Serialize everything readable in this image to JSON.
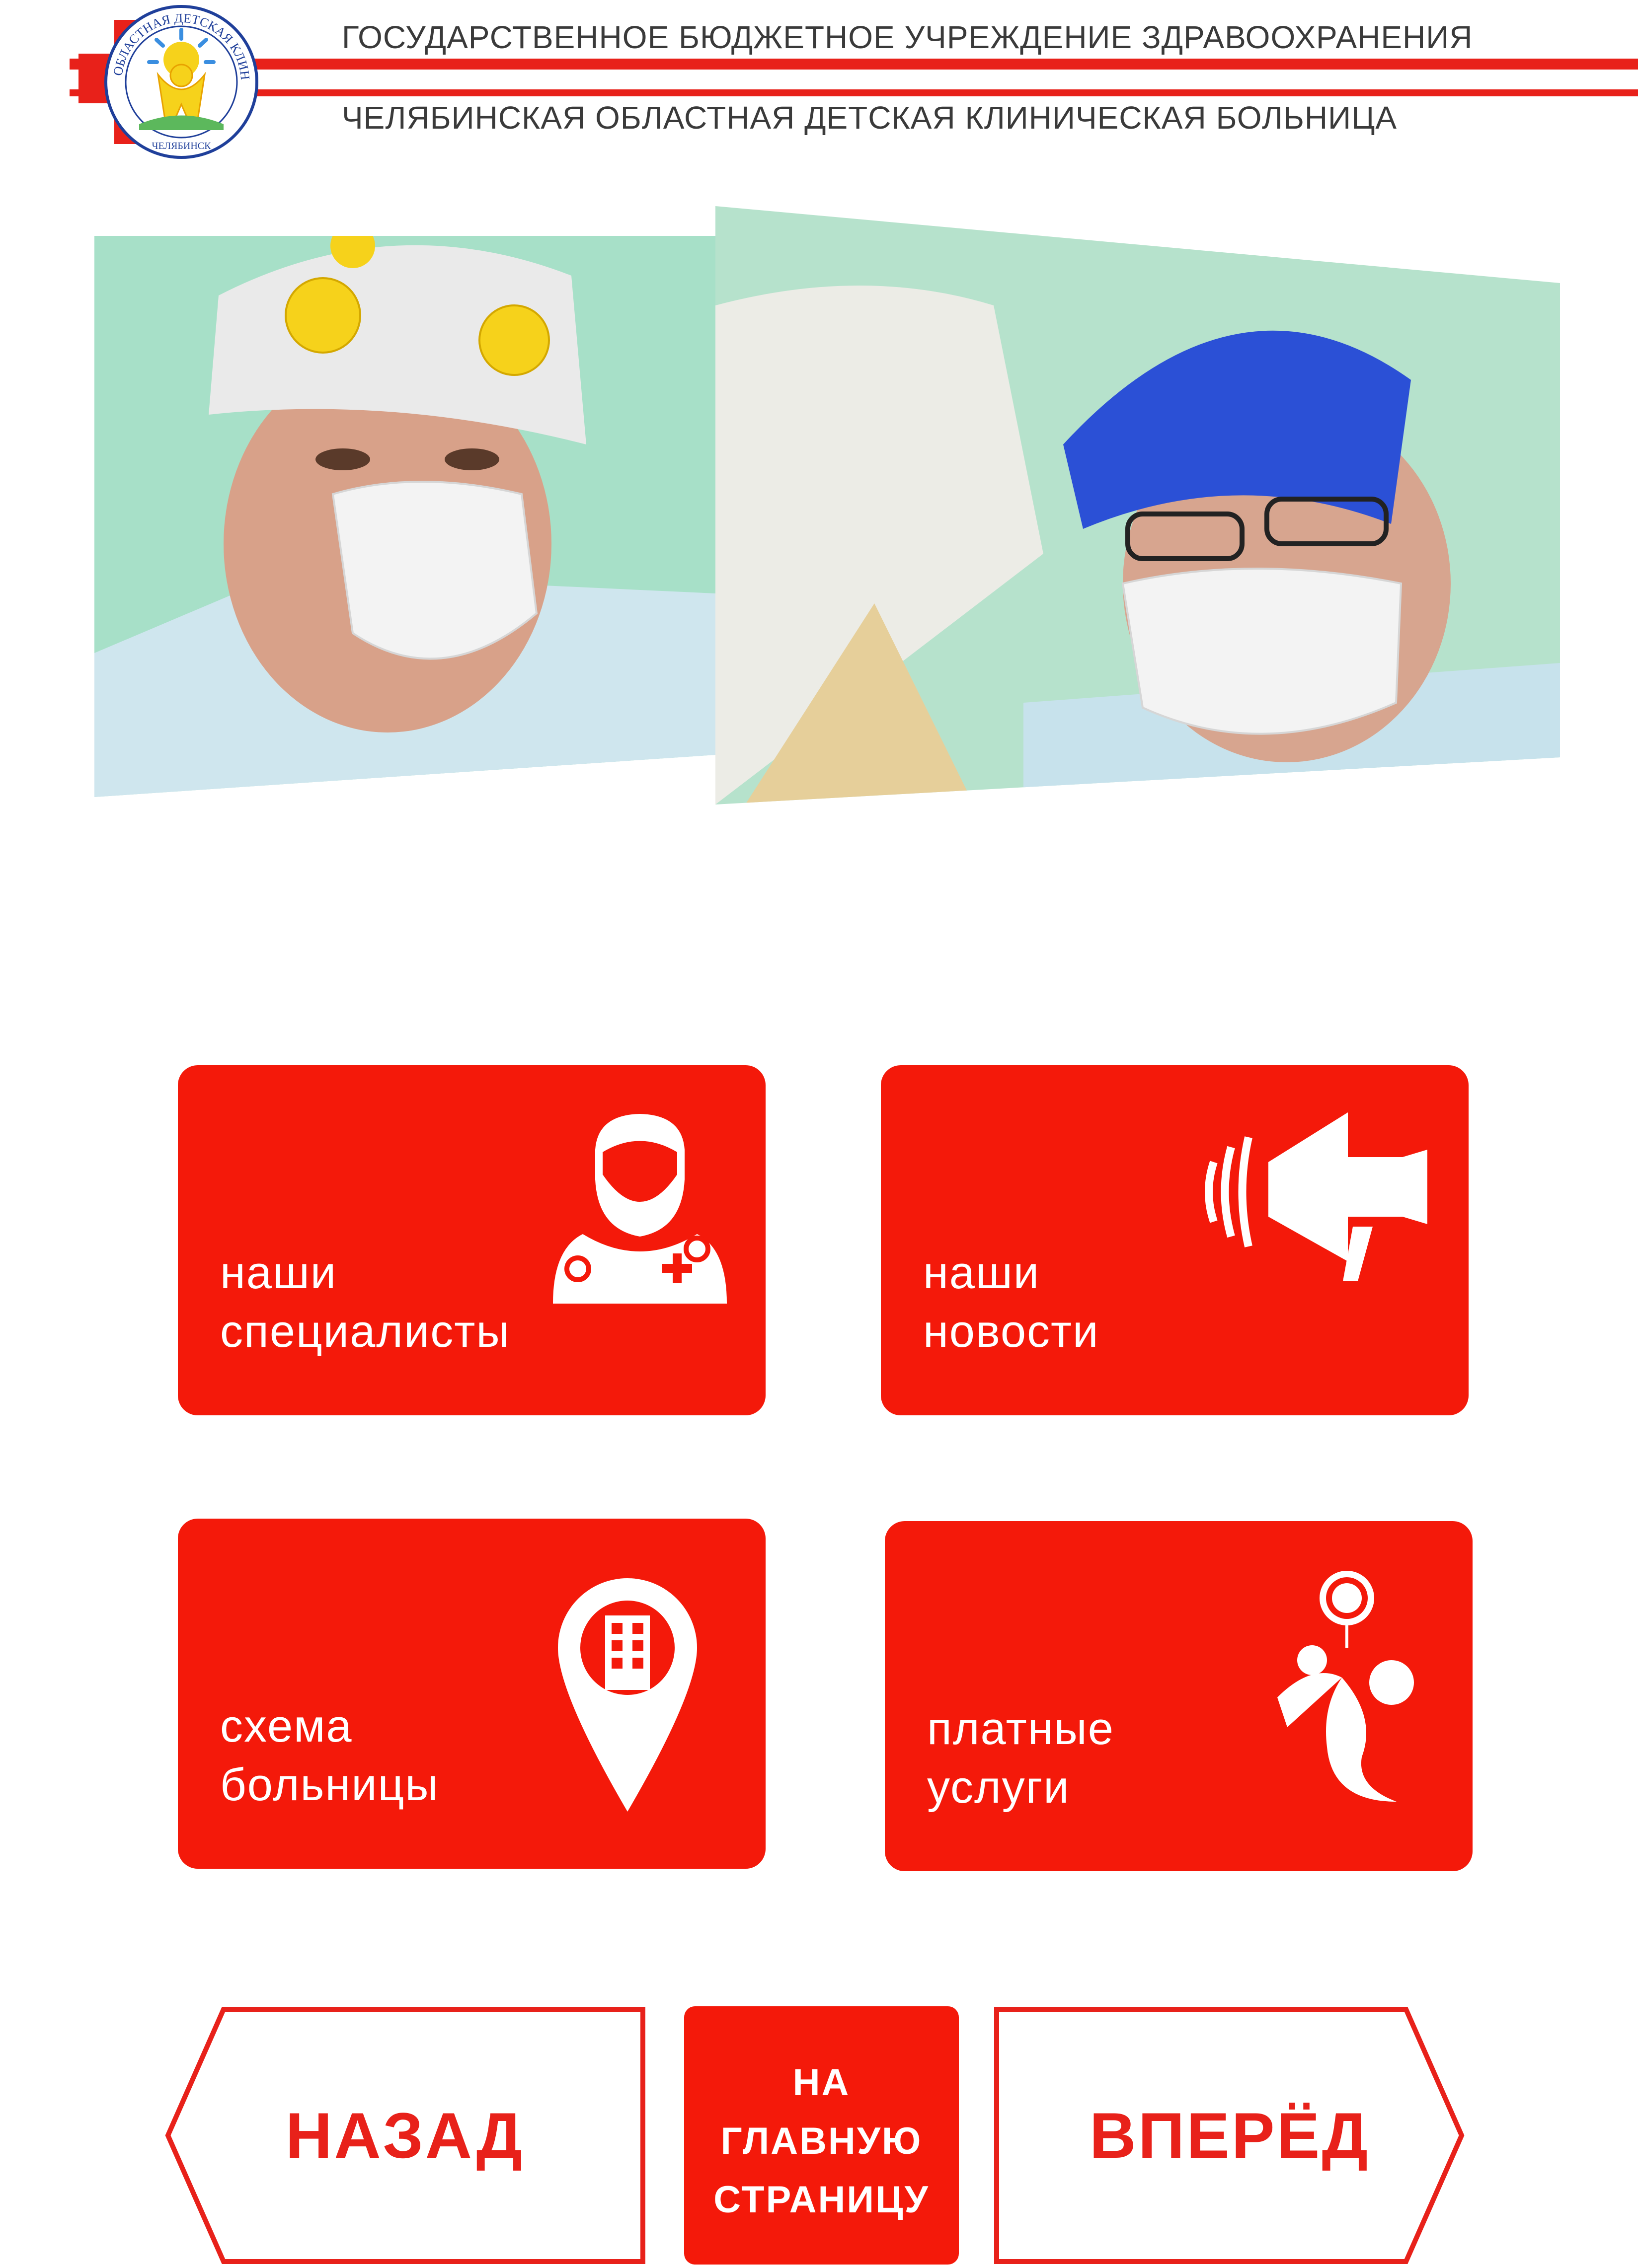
{
  "header": {
    "line1": "ГОСУДАРСТВЕННОЕ БЮДЖЕТНОЕ УЧРЕЖДЕНИЕ ЗДРАВООХРАНЕНИЯ",
    "line2": "ЧЕЛЯБИНСКАЯ ОБЛАСТНАЯ ДЕТСКАЯ КЛИНИЧЕСКАЯ БОЛЬНИЦА",
    "logo_ring_text": "ОБЛАСТНАЯ ДЕТСКАЯ КЛИНИЧЕСКАЯ БОЛЬНИЦА",
    "logo_city": "ЧЕЛЯБИНСК"
  },
  "colors": {
    "accent": "#e8211a",
    "tile": "#f4190a"
  },
  "tiles": [
    {
      "line1": "наши",
      "line2": "специалисты",
      "icon": "doctor-icon"
    },
    {
      "line1": "наши",
      "line2": "новости",
      "icon": "megaphone-icon"
    },
    {
      "line1": "схема",
      "line2": "больницы",
      "icon": "map-pin-building-icon"
    },
    {
      "line1": "платные",
      "line2": "услуги",
      "icon": "child-with-logo-icon"
    }
  ],
  "nav": {
    "back": "НАЗАД",
    "home_line1": "НА",
    "home_line2": "ГЛАВНУЮ",
    "home_line3": "СТРАНИЦУ",
    "forward": "ВПЕРЁД"
  }
}
